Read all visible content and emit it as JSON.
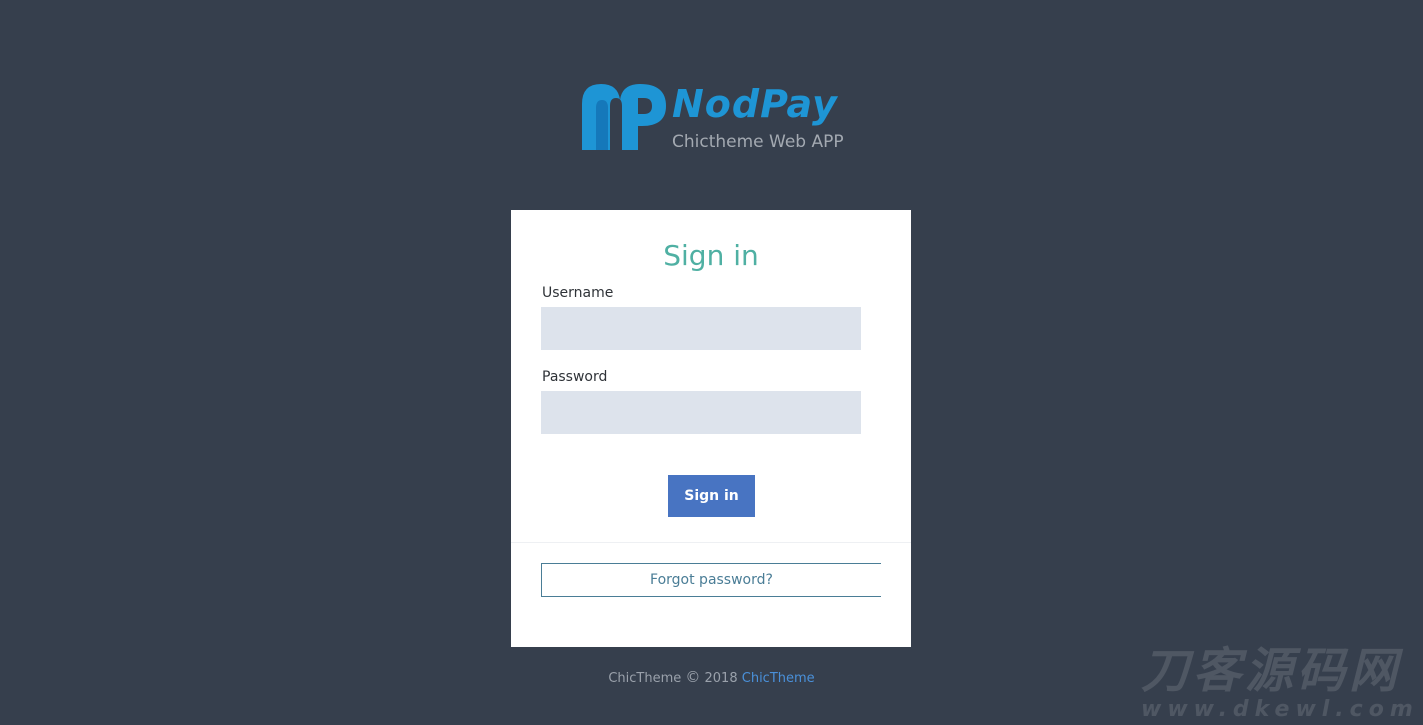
{
  "logo": {
    "name": "NodPay",
    "tagline": "Chictheme Web APP",
    "color": "#1e95d5"
  },
  "signin_form": {
    "title": "Sign in",
    "username_label": "Username",
    "username_value": "",
    "password_label": "Password",
    "password_value": "",
    "submit_label": "Sign in",
    "forgot_label": "Forgot password?"
  },
  "footer": {
    "text": "ChicTheme",
    "copyright_symbol": "©",
    "year": "2018",
    "link_text": "ChicTheme"
  },
  "watermark": {
    "cn_text": "刀客源码网",
    "url_text": "www.dkewl.com"
  },
  "colors": {
    "background": "#363f4d",
    "card": "#ffffff",
    "title": "#4fb0a3",
    "input_bg": "#dde3ec",
    "button": "#4874c2",
    "link": "#4a90d9"
  }
}
